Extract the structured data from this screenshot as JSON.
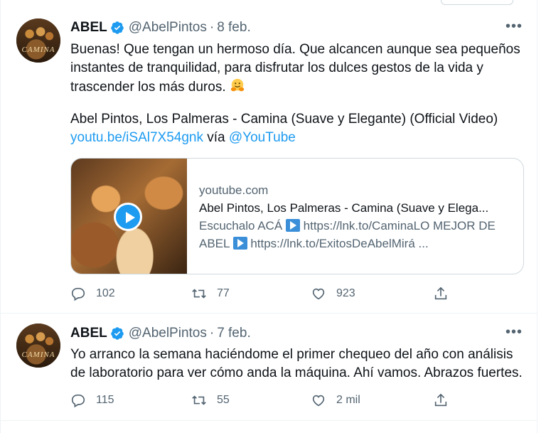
{
  "tweets": [
    {
      "name": "ABEL",
      "handle": "@AbelPintos",
      "separator": "·",
      "date": "8 feb.",
      "avatar_text": "CAMINA",
      "text_part1": "Buenas! Que tengan un hermoso día. Que alcancen aunque sea pequeños instantes de tranquilidad, para disfrutar los dulces gestos de la vida y trascender los más duros.",
      "text_part2_line": "Abel Pintos, Los Palmeras - Camina (Suave y Elegante) (Official Video)",
      "text_link": "youtu.be/iSAl7X54gnk",
      "text_via": "vía",
      "text_mention": "@YouTube",
      "card": {
        "domain": "youtube.com",
        "title": "Abel Pintos, Los Palmeras - Camina (Suave y Elega...",
        "desc_part1": "Escuchalo ACÁ",
        "desc_part2": "https://lnk.to/CaminaLO MEJOR DE ABEL",
        "desc_part3": "https://lnk.to/ExitosDeAbelMirá ..."
      },
      "replies": "102",
      "retweets": "77",
      "likes": "923"
    },
    {
      "name": "ABEL",
      "handle": "@AbelPintos",
      "separator": "·",
      "date": "7 feb.",
      "avatar_text": "CAMINA",
      "text": "Yo arranco la semana haciéndome el primer chequeo del año con análisis de laboratorio para ver cómo anda la máquina. Ahí vamos. Abrazos fuertes.",
      "replies": "115",
      "retweets": "55",
      "likes": "2 mil"
    }
  ],
  "more_label": "•••",
  "colors": {
    "accent": "#1d9bf0",
    "muted": "#536471",
    "text": "#0f1419",
    "border": "#eff3f4"
  },
  "icons": [
    "verified-badge-icon",
    "more-icon",
    "reply-icon",
    "retweet-icon",
    "like-icon",
    "share-icon",
    "hugging-face-emoji-icon",
    "play-icon",
    "play-button-emoji-icon"
  ]
}
